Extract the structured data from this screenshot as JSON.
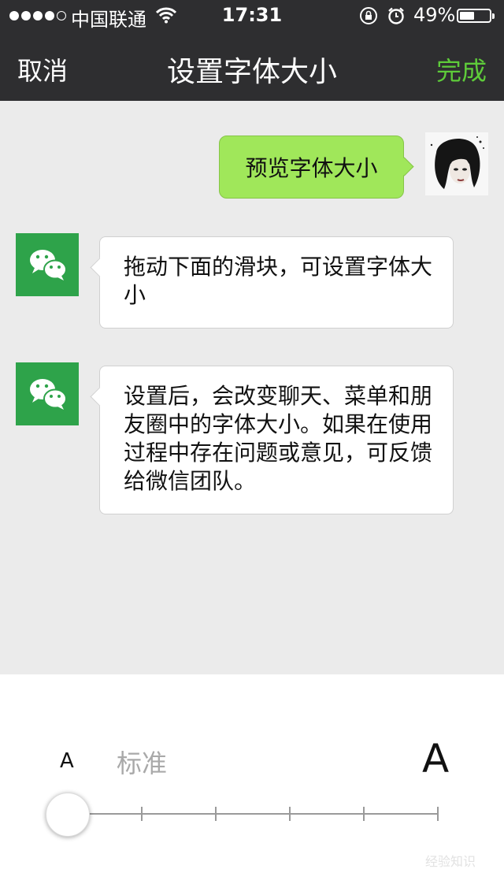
{
  "status_bar": {
    "carrier": "中国联通",
    "time": "17:31",
    "battery": "49%",
    "battery_level": 0.49,
    "signal_bars": 4,
    "wifi_icon": "wifi-icon",
    "lock_icon": "rotation-lock-icon",
    "alarm_icon": "alarm-icon"
  },
  "nav": {
    "cancel": "取消",
    "title": "设置字体大小",
    "done": "完成",
    "done_color": "#5ecb3a"
  },
  "chat": {
    "user_message": "预览字体大小",
    "bot_messages": [
      "拖动下面的滑块，可设置字体大小",
      "设置后，会改变聊天、菜单和朋友圈中的字体大小。如果在使用过程中存在问题或意见，可反馈给微信团队。"
    ],
    "bubble_color": "#a0e75a",
    "bot_avatar_color": "#2ea34a"
  },
  "font_slider": {
    "small_label": "A",
    "current_label": "标准",
    "large_label": "A",
    "level_index": 0,
    "level_count": 6
  },
  "watermark": "经验知识"
}
